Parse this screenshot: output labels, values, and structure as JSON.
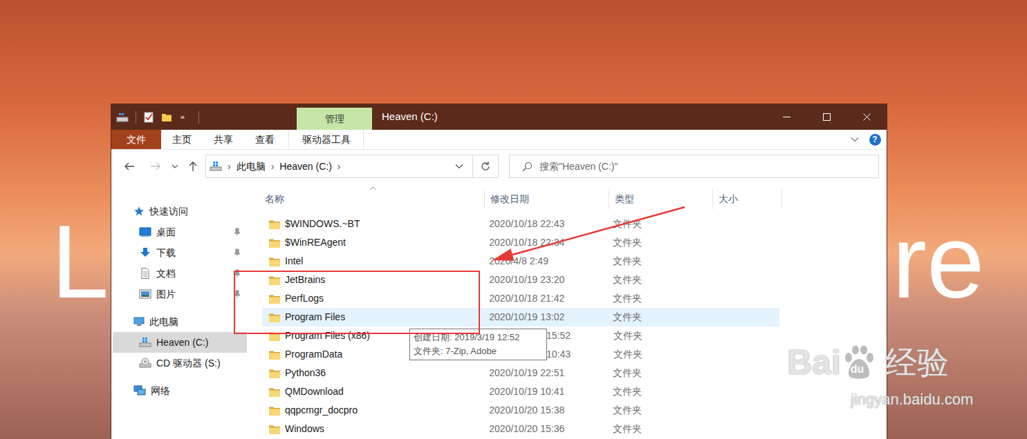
{
  "window": {
    "title": "Heaven (C:)",
    "context_tab": "管理"
  },
  "wallpaper_text": [
    "L",
    "re"
  ],
  "ribbon_tabs": [
    {
      "label": "文件",
      "selected": true
    },
    {
      "label": "主页",
      "selected": false
    },
    {
      "label": "共享",
      "selected": false
    },
    {
      "label": "查看",
      "selected": false
    },
    {
      "label": "驱动器工具",
      "selected": false
    }
  ],
  "help_button": "?",
  "address": {
    "path": [
      "此电脑",
      "Heaven (C:)"
    ],
    "separator": "›"
  },
  "search": {
    "placeholder": "搜索\"Heaven (C:)\""
  },
  "sidebar": {
    "items": [
      {
        "label": "快速访问",
        "kind": "group",
        "pinned": false,
        "selected": false
      },
      {
        "label": "桌面",
        "kind": "child",
        "pinned": true,
        "selected": false
      },
      {
        "label": "下载",
        "kind": "child",
        "pinned": true,
        "selected": false
      },
      {
        "label": "文档",
        "kind": "child",
        "pinned": true,
        "selected": false
      },
      {
        "label": "图片",
        "kind": "child",
        "pinned": true,
        "selected": false
      },
      {
        "label": "此电脑",
        "kind": "group",
        "pinned": false,
        "selected": false
      },
      {
        "label": "Heaven (C:)",
        "kind": "child",
        "pinned": false,
        "selected": true
      },
      {
        "label": "CD 驱动器 (S:)",
        "kind": "child",
        "pinned": false,
        "selected": false
      },
      {
        "label": "网络",
        "kind": "group",
        "pinned": false,
        "selected": false
      }
    ]
  },
  "table": {
    "columns": [
      {
        "label": "名称",
        "sorted": true
      },
      {
        "label": "修改日期",
        "sorted": false
      },
      {
        "label": "类型",
        "sorted": false
      },
      {
        "label": "大小",
        "sorted": false
      }
    ],
    "rows": [
      {
        "name": "$WINDOWS.~BT",
        "modified": "2020/10/18 22:43",
        "type": "文件夹",
        "selected": false,
        "partly_hidden": false
      },
      {
        "name": "$WinREAgent",
        "modified": "2020/10/18 22:34",
        "type": "文件夹",
        "selected": false,
        "partly_hidden": false
      },
      {
        "name": "Intel",
        "modified": "2020/4/8 2:49",
        "type": "文件夹",
        "selected": false,
        "partly_hidden": false
      },
      {
        "name": "JetBrains",
        "modified": "2020/10/19 23:20",
        "type": "文件夹",
        "selected": false,
        "partly_hidden": false
      },
      {
        "name": "PerfLogs",
        "modified": "2020/10/18 21:42",
        "type": "文件夹",
        "selected": false,
        "partly_hidden": false
      },
      {
        "name": "Program Files",
        "modified": "2020/10/19 13:02",
        "type": "文件夹",
        "selected": true,
        "partly_hidden": false
      },
      {
        "name": "Program Files (x86)",
        "modified": "15:52",
        "type": "文件夹",
        "selected": false,
        "partly_hidden": true
      },
      {
        "name": "ProgramData",
        "modified": "10:43",
        "type": "文件夹",
        "selected": false,
        "partly_hidden": true
      },
      {
        "name": "Python36",
        "modified": "2020/10/19 22:51",
        "type": "文件夹",
        "selected": false,
        "partly_hidden": false
      },
      {
        "name": "QMDownload",
        "modified": "2020/10/19 10:41",
        "type": "文件夹",
        "selected": false,
        "partly_hidden": false
      },
      {
        "name": "qqpcmgr_docpro",
        "modified": "2020/10/20 15:38",
        "type": "文件夹",
        "selected": false,
        "partly_hidden": false
      },
      {
        "name": "Windows",
        "modified": "2020/10/20 15:36",
        "type": "文件夹",
        "selected": false,
        "partly_hidden": false
      }
    ]
  },
  "tooltip": {
    "lines": [
      "创建日期: 2019/3/19 12:52",
      "文件夹: 7-Zip, Adobe"
    ]
  },
  "watermark": {
    "logo_left": "Bai",
    "logo_paw": "du",
    "brand": "经验",
    "url": "jingyan.baidu.com"
  }
}
